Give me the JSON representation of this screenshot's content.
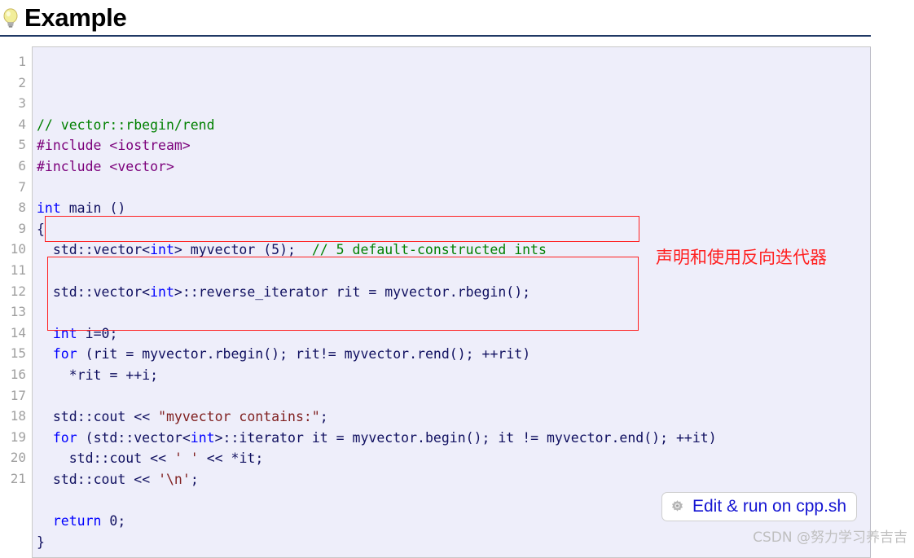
{
  "header": {
    "title": "Example",
    "icon": "lightbulb-icon"
  },
  "code_block": {
    "language": "cpp",
    "background_color": "#eeeefa",
    "gutter_color": "#a0a0a0",
    "first_line_number": 1,
    "line_numbers": [
      "1",
      "2",
      "3",
      "4",
      "5",
      "6",
      "7",
      "8",
      "9",
      "10",
      "11",
      "12",
      "13",
      "14",
      "15",
      "16",
      "17",
      "18",
      "19",
      "20",
      "21"
    ],
    "lines": [
      {
        "n": 1,
        "text": "// vector::rbegin/rend"
      },
      {
        "n": 2,
        "text": "#include <iostream>"
      },
      {
        "n": 3,
        "text": "#include <vector>"
      },
      {
        "n": 4,
        "text": ""
      },
      {
        "n": 5,
        "text": "int main ()"
      },
      {
        "n": 6,
        "text": "{"
      },
      {
        "n": 7,
        "text": "  std::vector<int> myvector (5);  // 5 default-constructed ints"
      },
      {
        "n": 8,
        "text": ""
      },
      {
        "n": 9,
        "text": "  std::vector<int>::reverse_iterator rit = myvector.rbegin();"
      },
      {
        "n": 10,
        "text": ""
      },
      {
        "n": 11,
        "text": "  int i=0;"
      },
      {
        "n": 12,
        "text": "  for (rit = myvector.rbegin(); rit!= myvector.rend(); ++rit)"
      },
      {
        "n": 13,
        "text": "    *rit = ++i;"
      },
      {
        "n": 14,
        "text": ""
      },
      {
        "n": 15,
        "text": "  std::cout << \"myvector contains:\";"
      },
      {
        "n": 16,
        "text": "  for (std::vector<int>::iterator it = myvector.begin(); it != myvector.end(); ++it)"
      },
      {
        "n": 17,
        "text": "    std::cout << ' ' << *it;"
      },
      {
        "n": 18,
        "text": "  std::cout << '\\n';"
      },
      {
        "n": 19,
        "text": ""
      },
      {
        "n": 20,
        "text": "  return 0;"
      },
      {
        "n": 21,
        "text": "}"
      }
    ],
    "token_colors": {
      "comment": "#008000",
      "preprocessor": "#7b007b",
      "keyword": "#0000ff",
      "string": "#802020",
      "plain": "#101060"
    }
  },
  "annotations": {
    "highlight_color": "#ff2020",
    "boxes": [
      {
        "id": "declaration-box",
        "target_lines": "9"
      },
      {
        "id": "usage-box",
        "target_lines": "11-13"
      }
    ],
    "note": "声明和使用反向迭代器"
  },
  "edit_run_button": {
    "label": "Edit & run on cpp.sh",
    "icon": "gear-icon",
    "text_color": "#1414d2"
  },
  "watermark": {
    "text": "CSDN @努力学习养吉吉",
    "color": "#bfbfbf"
  }
}
